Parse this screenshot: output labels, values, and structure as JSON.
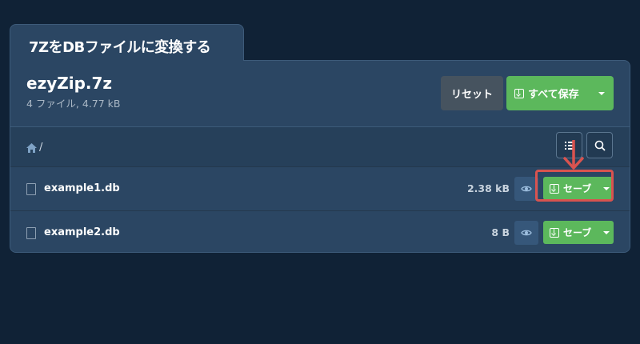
{
  "tab": {
    "title": "7ZをDBファイルに変換する"
  },
  "archive": {
    "name": "ezyZip.7z",
    "meta": "4 ファイル, 4.77 kB"
  },
  "actions": {
    "reset_label": "リセット",
    "save_all_label": "すべて保存"
  },
  "breadcrumb": {
    "separator": "/"
  },
  "files": [
    {
      "name": "example1.db",
      "size": "2.38 kB",
      "save_label": "セーブ"
    },
    {
      "name": "example2.db",
      "size": "8 B",
      "save_label": "セーブ"
    }
  ],
  "colors": {
    "accent_green": "#5cb85c",
    "highlight_red": "#d9534f",
    "background": "#102236",
    "panel": "#2b4663"
  }
}
